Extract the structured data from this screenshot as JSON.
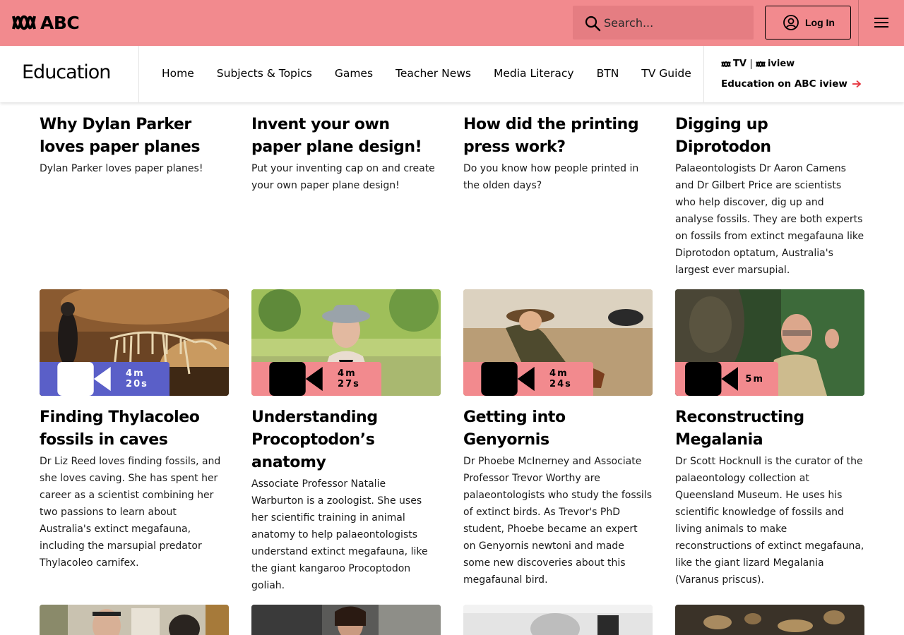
{
  "header": {
    "logo_text": "ABC",
    "search_placeholder": "Search...",
    "login_label": "Log In",
    "colors": {
      "brand_bar": "#f28a8e",
      "search_bg": "#e57d82",
      "active_badge": "#5a5fc8"
    }
  },
  "subnav": {
    "brand": "Education",
    "links": [
      "Home",
      "Subjects & Topics",
      "Games",
      "Teacher News",
      "Media Literacy",
      "BTN",
      "TV Guide"
    ],
    "iview_logo_tv": "TV",
    "iview_logo_iview": "iview",
    "iview_link": "Education on ABC iview"
  },
  "cards_top": [
    {
      "title": "Why Dylan Parker loves paper planes",
      "desc": "Dylan Parker loves paper planes!"
    },
    {
      "title": "Invent your own paper plane design!",
      "desc": "Put your inventing cap on and create your own paper plane design!"
    },
    {
      "title": "How did the printing press work?",
      "desc": "Do you know how people printed in the olden days?"
    },
    {
      "title": "Digging up Diprotodon",
      "desc": "Palaeontologists Dr Aaron Camens and Dr Gilbert Price are scientists who help discover, dig up and analyse fossils. They are both experts on fossils from extinct megafauna like Diprotodon optatum, Australia's largest ever marsupial."
    }
  ],
  "cards_mid": [
    {
      "title": "Finding Thylacoleo fossils in caves",
      "duration": "4m 20s",
      "desc": "Dr Liz Reed loves finding fossils, and she loves caving. She has spent her career as a scientist combining her two passions to learn about Australia's extinct megafauna, including the marsupial predator Thylacoleo carnifex."
    },
    {
      "title": "Understanding Procoptodon’s anatomy",
      "duration": "4m 27s",
      "desc": "Associate Professor Natalie Warburton is a zoologist. She uses her scientific training in animal anatomy to help palaeontologists understand extinct megafauna, like the giant kangaroo Procoptodon goliah."
    },
    {
      "title": "Getting into Genyornis",
      "duration": "4m 24s",
      "desc": "Dr Phoebe McInerney and Associate Professor Trevor Worthy are palaeontologists who study the fossils of extinct birds. As Trevor's PhD student, Phoebe became an expert on Genyornis newtoni and made some new discoveries about this megafaunal bird."
    },
    {
      "title": "Reconstructing Megalania",
      "duration": "5m",
      "desc": "Dr Scott Hocknull is the curator of the palaeontology collection at Queensland Museum. He uses his scientific knowledge of fossils and living animals to make reconstructions of extinct megafauna, like the giant lizard Megalania (Varanus priscus)."
    }
  ]
}
